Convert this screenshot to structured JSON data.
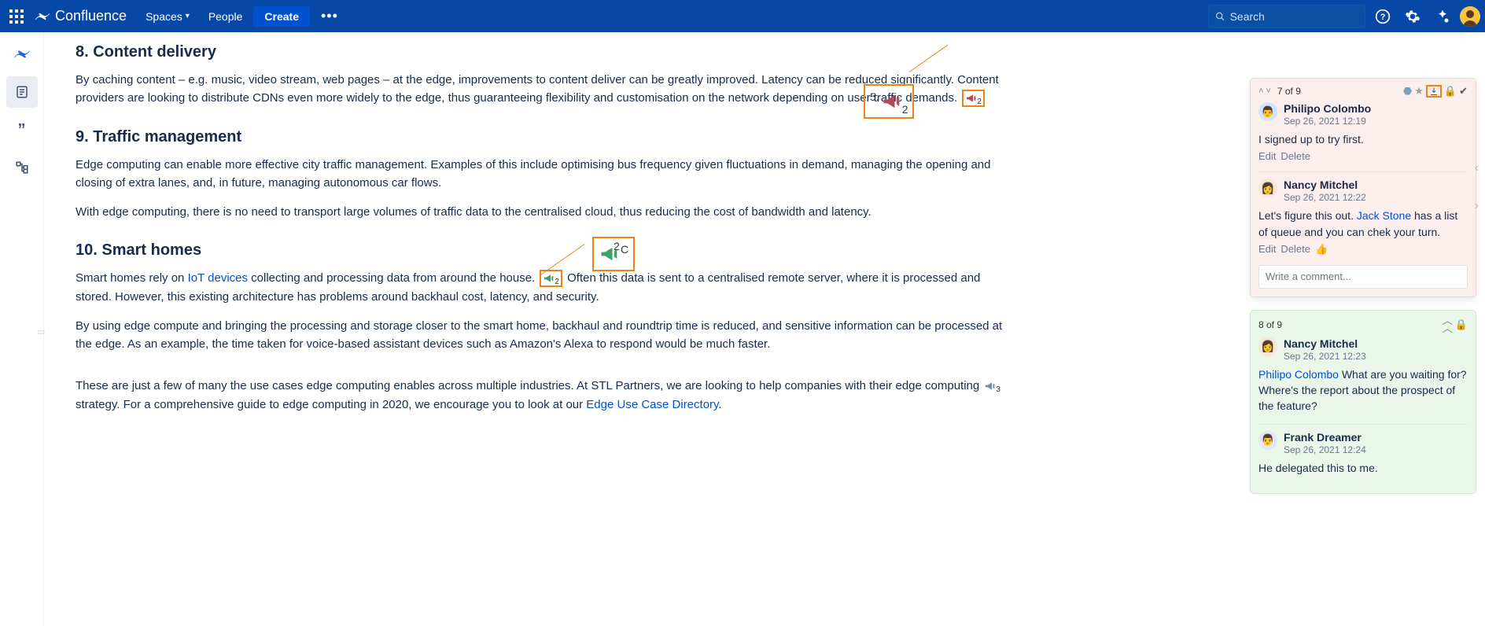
{
  "nav": {
    "brand": "Confluence",
    "spaces": "Spaces",
    "people": "People",
    "create": "Create",
    "search_placeholder": "Search"
  },
  "article": {
    "s8_title": "8. Content delivery",
    "s8_p1": "By caching content – e.g. music, video stream, web pages – at the edge, improvements to content deliver can be greatly improved. Latency can be reduced significantly. Content providers are looking to distribute CDNs even more widely to the edge, thus guaranteeing flexibility and customisation on the network depending on user traffic demands.",
    "s9_title": "9. Traffic management",
    "s9_p1": "Edge computing can enable more effective city traffic management. Examples of this include optimising bus frequency given fluctuations in demand, managing the opening and closing of extra lanes, and, in future, managing autonomous car flows.",
    "s9_p2": "With edge computing, there is no need to transport large volumes of traffic data to the centralised cloud, thus reducing the cost of bandwidth and latency.",
    "s10_title": "10. Smart homes",
    "s10_p1_a": "Smart homes rely on ",
    "s10_link1": "IoT devices",
    "s10_p1_b": " collecting and processing data from around the house. ",
    "s10_p1_c": "Often this data is sent to a centralised remote server, where it is processed and stored. However, this existing architecture has problems around backhaul cost, latency, and security.",
    "s10_p2": "By using edge compute and bringing the processing and storage closer to the smart home, backhaul and roundtrip time is reduced, and sensitive information can be processed at the edge. As an example, the time taken for voice-based assistant devices such as Amazon's Alexa to respond would be much faster.",
    "closing_a": "These are just a few of many the use cases edge computing enables across multiple industries. At STL Partners, we are looking to help companies with their edge computing",
    "closing_b": " strategy. For a comprehensive guide to edge computing in 2020, we encourage you to look at our ",
    "closing_link": "Edge Use Case Directory",
    "closing_c": "."
  },
  "markers": {
    "m1_count": "2",
    "m2_prefix": "5.",
    "m2_count": "2",
    "m3_count": "2",
    "m3b_suffix": "C",
    "m4_count": "2",
    "m5_count": "3"
  },
  "threads": {
    "t1": {
      "counter": "7 of 9",
      "c1_author": "Philipo Colombo",
      "c1_date": "Sep 26, 2021 12:19",
      "c1_body": "I signed up to try first.",
      "edit": "Edit",
      "delete": "Delete",
      "c2_author": "Nancy Mitchel",
      "c2_date": "Sep 26, 2021 12:22",
      "c2_body_a": "Let's figure this out. ",
      "c2_mention": "Jack Stone",
      "c2_body_b": " has a list of queue and you can chek your turn.",
      "reply_placeholder": "Write a comment..."
    },
    "t2": {
      "counter": "8 of 9",
      "c1_author": "Nancy Mitchel",
      "c1_date": "Sep 26, 2021 12:23",
      "c1_mention": "Philipo Colombo",
      "c1_body": " What are you waiting for? Where's the report about the prospect of the feature?",
      "c2_author": "Frank Dreamer",
      "c2_date": "Sep 26, 2021 12:24",
      "c2_body": "He delegated this to me."
    }
  }
}
